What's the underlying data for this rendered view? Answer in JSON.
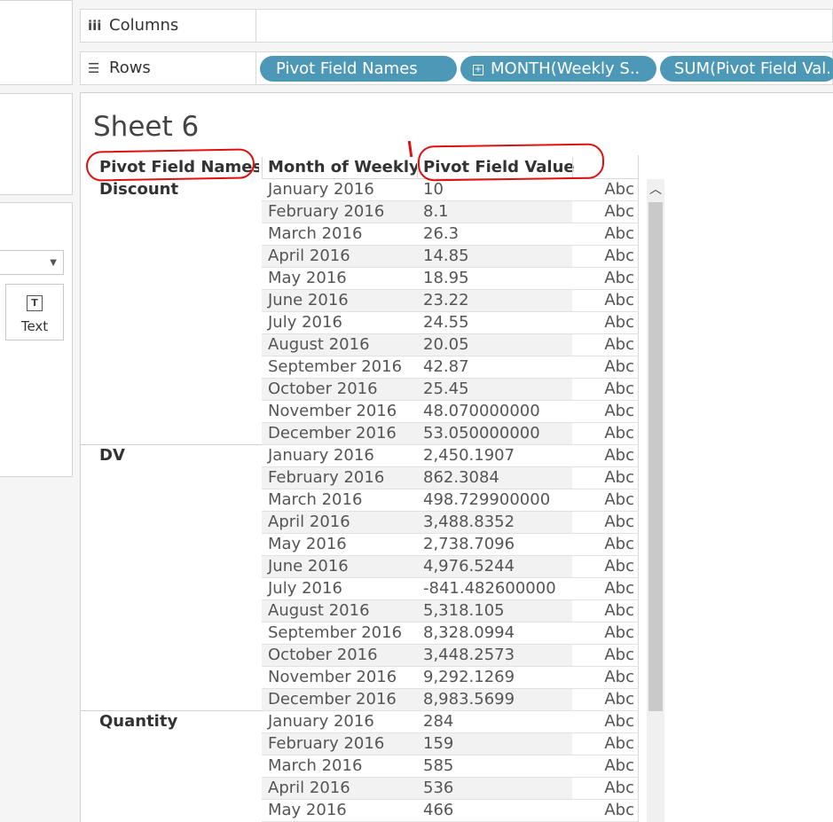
{
  "left_panel": {
    "text_button_label": "Text"
  },
  "shelves": {
    "columns_label": "Columns",
    "rows_label": "Rows",
    "rows_pills": [
      "Pivot Field Names",
      "MONTH(Weekly S..",
      "SUM(Pivot Field Val.."
    ]
  },
  "sheet": {
    "title": "Sheet 6",
    "headers": {
      "names": "Pivot Field Names",
      "month": "Month of Weekly ..",
      "values": "Pivot Field Values"
    },
    "abc": "Abc",
    "groups": [
      {
        "name": "Discount",
        "rows": [
          [
            "January 2016",
            "10"
          ],
          [
            "February 2016",
            "8.1"
          ],
          [
            "March 2016",
            "26.3"
          ],
          [
            "April 2016",
            "14.85"
          ],
          [
            "May 2016",
            "18.95"
          ],
          [
            "June 2016",
            "23.22"
          ],
          [
            "July 2016",
            "24.55"
          ],
          [
            "August 2016",
            "20.05"
          ],
          [
            "September 2016",
            "42.87"
          ],
          [
            "October 2016",
            "25.45"
          ],
          [
            "November 2016",
            "48.070000000"
          ],
          [
            "December 2016",
            "53.050000000"
          ]
        ]
      },
      {
        "name": "DV",
        "rows": [
          [
            "January 2016",
            "2,450.1907"
          ],
          [
            "February 2016",
            "862.3084"
          ],
          [
            "March 2016",
            "498.729900000"
          ],
          [
            "April 2016",
            "3,488.8352"
          ],
          [
            "May 2016",
            "2,738.7096"
          ],
          [
            "June 2016",
            "4,976.5244"
          ],
          [
            "July 2016",
            "-841.482600000"
          ],
          [
            "August 2016",
            "5,318.105"
          ],
          [
            "September 2016",
            "8,328.0994"
          ],
          [
            "October 2016",
            "3,448.2573"
          ],
          [
            "November 2016",
            "9,292.1269"
          ],
          [
            "December 2016",
            "8,983.5699"
          ]
        ]
      },
      {
        "name": "Quantity",
        "rows": [
          [
            "January 2016",
            "284"
          ],
          [
            "February 2016",
            "159"
          ],
          [
            "March 2016",
            "585"
          ],
          [
            "April 2016",
            "536"
          ],
          [
            "May 2016",
            "466"
          ]
        ]
      }
    ]
  }
}
